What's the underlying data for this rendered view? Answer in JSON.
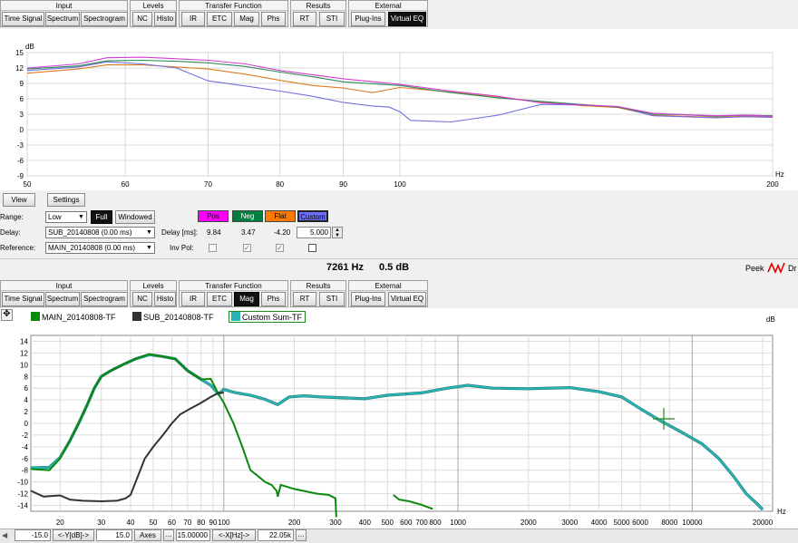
{
  "toolbar_groups": [
    {
      "title": "Input",
      "buttons": [
        "Time Signal",
        "Spectrum",
        "Spectrogram"
      ]
    },
    {
      "title": "Levels",
      "buttons": [
        "NC",
        "Histo"
      ]
    },
    {
      "title": "Transfer Function",
      "buttons": [
        "IR",
        "ETC",
        "Mag",
        "Phs"
      ]
    },
    {
      "title": "Results",
      "buttons": [
        "RT",
        "STI"
      ]
    },
    {
      "title": "External",
      "buttons": [
        "Plug-Ins",
        "Virtual EQ"
      ]
    }
  ],
  "top_toolbar_active": "Virtual EQ",
  "bottom_toolbar_active": "Mag",
  "top_chart": {
    "ylabel": "dB",
    "xlabel": "Hz",
    "yticks": [
      "15",
      "12",
      "9",
      "6",
      "3",
      "0",
      "-3",
      "-6",
      "-9"
    ],
    "xticks": [
      "50",
      "60",
      "70",
      "80",
      "90",
      "100",
      "200"
    ]
  },
  "view_tabs": {
    "view": "View",
    "settings": "Settings"
  },
  "controls": {
    "range_label": "Range:",
    "range_value": "Low",
    "full_button": "Full",
    "windowed_button": "Windowed",
    "delay_label": "Delay:",
    "delay_value": "SUB_20140808 (0.00 ms)",
    "reference_label": "Reference:",
    "reference_value": "MAIN_20140808 (0.00 ms)",
    "delay_ms_label": "Delay [ms]:",
    "inv_pol_label": "Inv Pol:",
    "custom_delay_value": "5.000"
  },
  "combos": [
    {
      "label": "Pos",
      "color": "#ff00ff",
      "delay": "9.84",
      "inv_pol": false
    },
    {
      "label": "Neg",
      "color": "#008040",
      "delay": "3.47",
      "inv_pol": true
    },
    {
      "label": "Flat",
      "color": "#ff7a00",
      "delay": "-4.20",
      "inv_pol": true
    },
    {
      "label": "Custom",
      "color": "#6c6cff",
      "delay": "5.000",
      "inv_pol": false
    }
  ],
  "readout": {
    "frequency": "7261 Hz",
    "level": "0.5 dB"
  },
  "peek": {
    "label": "Peek",
    "trailing": "Dr"
  },
  "legend": [
    {
      "name": "MAIN_20140808-TF",
      "color": "#0a8a0a"
    },
    {
      "name": "SUB_20140808-TF",
      "color": "#333333"
    },
    {
      "name": "Custom Sum-TF",
      "color": "#29b3b3"
    }
  ],
  "bottom_chart": {
    "ylabel": "dB",
    "xlabel": "Hz",
    "yticks": [
      "14",
      "12",
      "10",
      "8",
      "6",
      "4",
      "2",
      "0",
      "-2",
      "-4",
      "-6",
      "-8",
      "-10",
      "-12",
      "-14"
    ],
    "xticks": [
      "20",
      "30",
      "40",
      "50",
      "60",
      "70",
      "80",
      "90",
      "100",
      "200",
      "300",
      "400",
      "500",
      "600",
      "700",
      "800",
      "1000",
      "2000",
      "3000",
      "4000",
      "5000",
      "6000",
      "8000",
      "10000",
      "20000"
    ]
  },
  "bottom_bar": {
    "ymin": "-15.0",
    "y_btn": "<-Y[dB]->",
    "ymax": "15.0",
    "axes_btn": "Axes",
    "dots_btn": "...",
    "xmin": "15.00000",
    "x_btn": "<-X[Hz]->",
    "xmax": "22.05k",
    "dots2_btn": "..."
  },
  "colors": {
    "pos": "#d23cd2",
    "neg": "#2e8b57",
    "flat": "#e07a20",
    "custom": "#7070e0",
    "main": "#0a8a0a",
    "sub": "#333333",
    "sum": "#29b3b3"
  }
}
